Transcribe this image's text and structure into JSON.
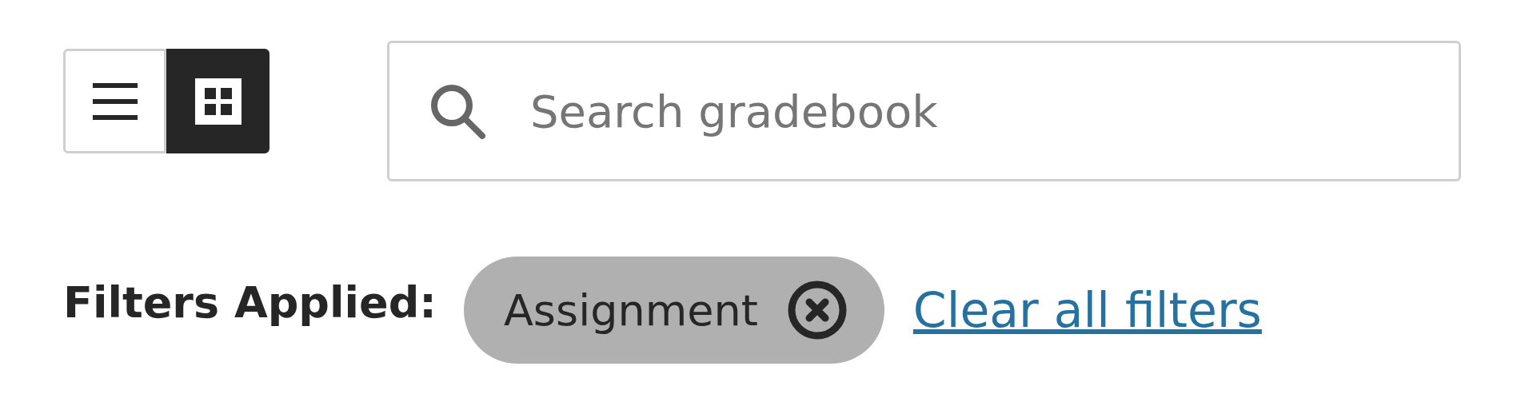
{
  "view_toggle": [
    {
      "kind": "list",
      "selected": false
    },
    {
      "kind": "grid",
      "selected": true
    }
  ],
  "search": {
    "placeholder": "Search gradebook"
  },
  "filters": {
    "label": "Filters Applied:",
    "chips": [
      {
        "label": "Assignment"
      }
    ],
    "clear_link": "Clear all filters"
  }
}
